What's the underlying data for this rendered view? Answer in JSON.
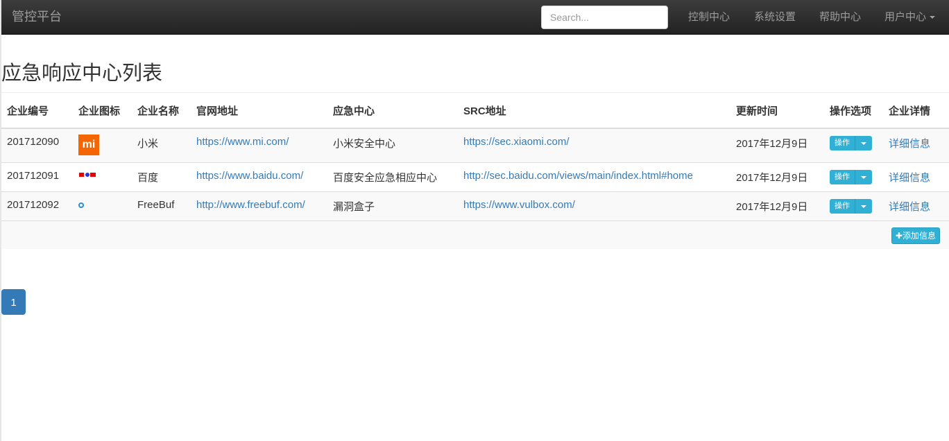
{
  "nav": {
    "brand": "管控平台",
    "search_placeholder": "Search...",
    "links": [
      "控制中心",
      "系统设置",
      "帮助中心",
      "用户中心"
    ]
  },
  "page_title": "应急响应中心列表",
  "table": {
    "headers": [
      "企业编号",
      "企业图标",
      "企业名称",
      "官网地址",
      "应急中心",
      "SRC地址",
      "更新时间",
      "操作选项",
      "企业详情"
    ],
    "rows": [
      {
        "id": "201712090",
        "logo": "xiaomi-logo",
        "name": "小米",
        "website": "https://www.mi.com/",
        "center": "小米安全中心",
        "src": "https://sec.xiaomi.com/",
        "updated": "2017年12月9日",
        "action": "操作",
        "detail": "详细信息"
      },
      {
        "id": "201712091",
        "logo": "baidu-logo",
        "name": "百度",
        "website": "https://www.baidu.com/",
        "center": "百度安全应急相应中心",
        "src": "http://sec.baidu.com/views/main/index.html#home",
        "updated": "2017年12月9日",
        "action": "操作",
        "detail": "详细信息"
      },
      {
        "id": "201712092",
        "logo": "freebuf-logo",
        "name": "FreeBuf",
        "website": "http://www.freebuf.com/",
        "center": "漏洞盒子",
        "src": "https://www.vulbox.com/",
        "updated": "2017年12月9日",
        "action": "操作",
        "detail": "详细信息"
      }
    ],
    "add_label": "添加信息",
    "mi_logo_text": "mi"
  },
  "pagination": {
    "current": "1"
  },
  "colors": {
    "navbar": "#222222",
    "accent": "#337ab7",
    "info_button": "#31b0d5",
    "xiaomi": "#f56600"
  }
}
